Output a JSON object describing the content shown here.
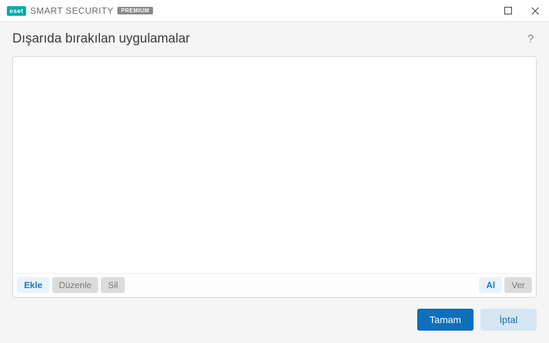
{
  "titlebar": {
    "logo_text": "eset",
    "product_name": "SMART SECURITY",
    "tier_badge": "PREMIUM"
  },
  "header": {
    "title": "Dışarıda bırakılan uygulamalar",
    "help_symbol": "?"
  },
  "toolbar": {
    "add": "Ekle",
    "edit": "Düzenle",
    "delete": "Sil",
    "import": "Al",
    "export": "Ver"
  },
  "footer": {
    "ok": "Tamam",
    "cancel": "İptal"
  }
}
